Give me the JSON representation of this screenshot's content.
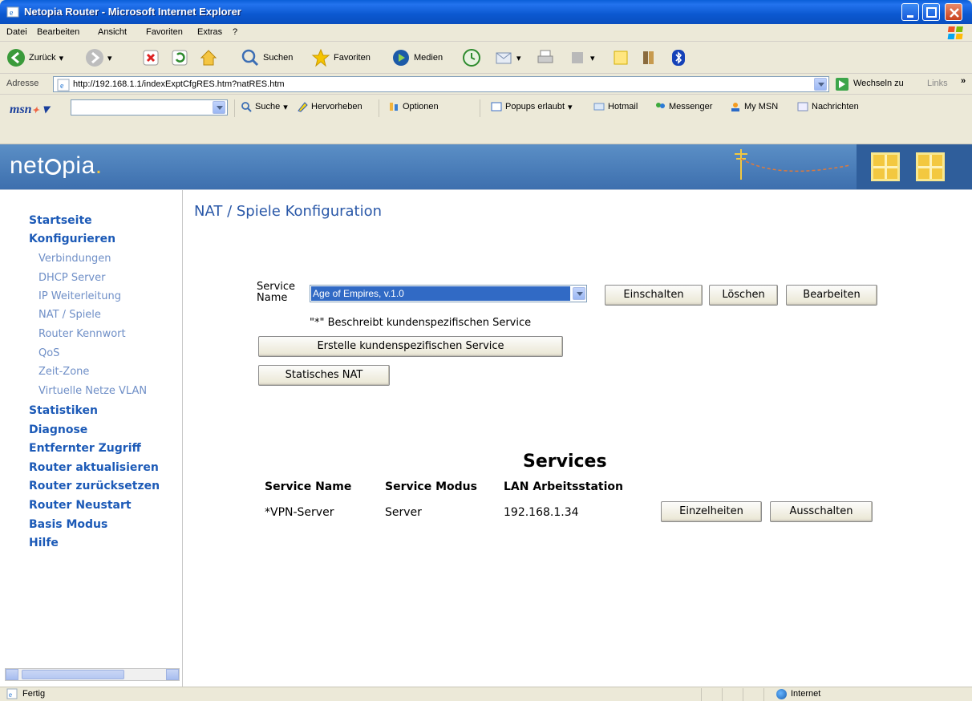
{
  "window": {
    "title": "Netopia Router - Microsoft Internet Explorer"
  },
  "menu": [
    "Datei",
    "Bearbeiten",
    "Ansicht",
    "Favoriten",
    "Extras",
    "?"
  ],
  "toolbar": {
    "back": "Zurück",
    "search": "Suchen",
    "favorites": "Favoriten",
    "media": "Medien"
  },
  "address": {
    "label": "Adresse",
    "url": "http://192.168.1.1/indexExptCfgRES.htm?natRES.htm",
    "go": "Wechseln zu",
    "links": "Links"
  },
  "msn": {
    "search": "Suche",
    "highlight": "Hervorheben",
    "options": "Optionen",
    "popups": "Popups erlaubt",
    "hotmail": "Hotmail",
    "messenger": "Messenger",
    "mymsn": "My MSN",
    "news": "Nachrichten"
  },
  "brand": {
    "logo_pre": "net",
    "logo_post": "pia",
    "logo_dot": "."
  },
  "sidebar": {
    "items": [
      {
        "label": "Startseite",
        "level": 1
      },
      {
        "label": "Konfigurieren",
        "level": 1
      },
      {
        "label": "Verbindungen",
        "level": 2
      },
      {
        "label": "DHCP Server",
        "level": 2
      },
      {
        "label": "IP Weiterleitung",
        "level": 2
      },
      {
        "label": "NAT / Spiele",
        "level": 2
      },
      {
        "label": "Router Kennwort",
        "level": 2
      },
      {
        "label": "QoS",
        "level": 2
      },
      {
        "label": "Zeit-Zone",
        "level": 2
      },
      {
        "label": "Virtuelle Netze VLAN",
        "level": 2
      },
      {
        "label": "Statistiken",
        "level": 1
      },
      {
        "label": "Diagnose",
        "level": 1
      },
      {
        "label": "Entfernter Zugriff",
        "level": 1
      },
      {
        "label": "Router aktualisieren",
        "level": 1
      },
      {
        "label": "Router zurücksetzen",
        "level": 1
      },
      {
        "label": "Router Neustart",
        "level": 1
      },
      {
        "label": "Basis Modus",
        "level": 1
      },
      {
        "label": "Hilfe",
        "level": 1
      }
    ]
  },
  "main": {
    "title": "NAT / Spiele Konfiguration",
    "service_label_1": "Service",
    "service_label_2": "Name",
    "service_select_value": "Age of Empires, v.1.0",
    "btn_enable": "Einschalten",
    "btn_delete": "Löschen",
    "btn_edit": "Bearbeiten",
    "note": "\"*\" Beschreibt kundenspezifischen Service",
    "btn_create_custom": "Erstelle kundenspezifischen Service",
    "btn_static_nat": "Statisches NAT",
    "services_heading": "Services",
    "table": {
      "headers": [
        "Service Name",
        "Service Modus",
        "LAN Arbeitsstation"
      ],
      "rows": [
        {
          "name": "*VPN-Server",
          "mode": "Server",
          "station": "192.168.1.34",
          "details": "Einzelheiten",
          "disable": "Ausschalten"
        }
      ]
    }
  },
  "statusbar": {
    "text": "Fertig",
    "zone": "Internet"
  }
}
